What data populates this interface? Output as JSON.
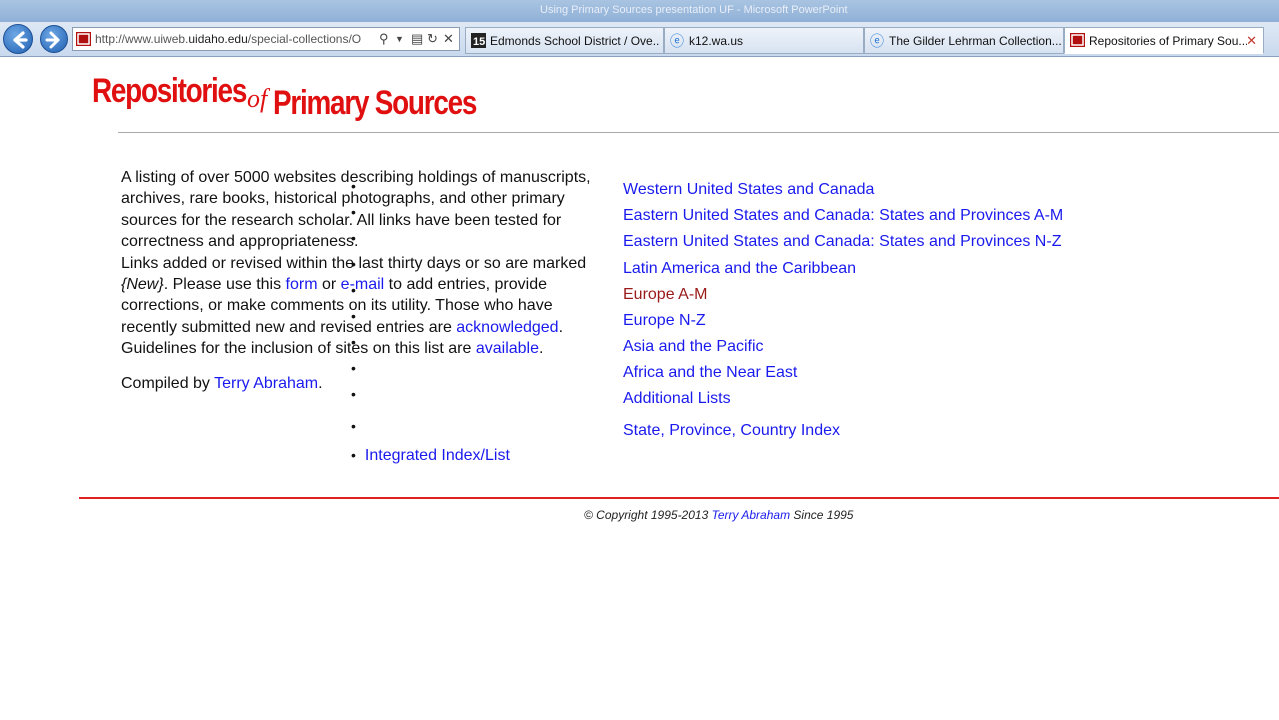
{
  "browser": {
    "title": "Using Primary Sources presentation UF - Microsoft PowerPoint",
    "address": {
      "prefix": "http://www.uiweb.",
      "domain": "uidaho.edu",
      "suffix": "/special-collections/O"
    },
    "tabs": [
      {
        "label": "Edmonds School District / Ove..."
      },
      {
        "label": "k12.wa.us"
      },
      {
        "label": "The Gilder Lehrman Collection..."
      },
      {
        "label": "Repositories of Primary Sou..."
      }
    ]
  },
  "logo": {
    "part1": "Repositories",
    "part2": "of",
    "part3": "Primary Sources"
  },
  "intro": {
    "p1": "A listing of over 5000 websites describing holdings of manuscripts, archives, rare books, historical photographs, and other primary sources for the research scholar. All links have been tested for correctness and appropriateness.",
    "p2a": "Links added or revised within the last thirty days or so are marked ",
    "new_tag": "{New}",
    "p2b": ". Please use this ",
    "form_link": "form",
    "or": " or ",
    "email_link": "e-mail",
    "p2c": " to add entries, provide corrections, or make comments on its utility. Those who have recently submitted new and revised entries are ",
    "ack_link": "acknowledged",
    "p2d": ". Guidelines for the inclusion of sites on this list are ",
    "avail_link": "available",
    "p2e": "."
  },
  "compiled": {
    "prefix": "Compiled by ",
    "name": "Terry Abraham",
    "suffix": "."
  },
  "bullet_char": "•",
  "integrated_link": "Integrated Index/List",
  "region_links": [
    "Western United States and Canada",
    "Eastern United States and Canada: States and Provinces A-M",
    "Eastern United States and Canada: States and Provinces N-Z",
    "Latin America and the Caribbean",
    "Europe A-M",
    "Europe N-Z",
    "Asia and the Pacific",
    "Africa and the Near East",
    "Additional Lists",
    "State, Province, Country Index"
  ],
  "footer": {
    "prefix": "© Copyright 1995-2013 ",
    "name": "Terry Abraham",
    "suffix": " Since 1995"
  },
  "colors": {
    "logo_red": "#e01010",
    "link_blue": "#1a1aee",
    "visited_link": "#9a1a1a",
    "rule_red": "#e02020"
  }
}
